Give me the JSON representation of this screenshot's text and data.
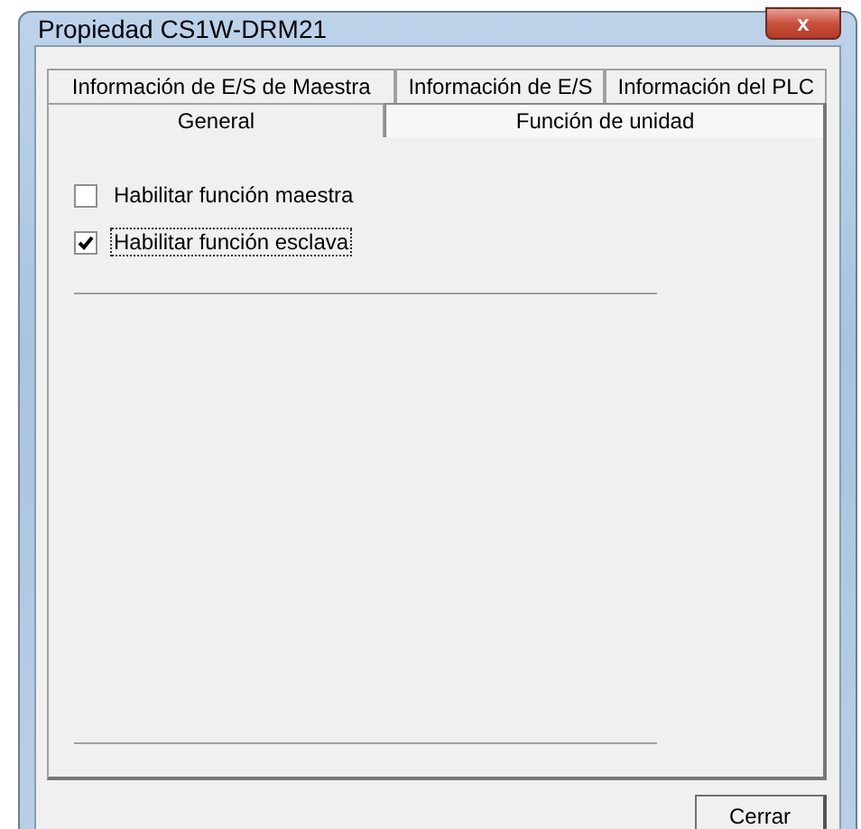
{
  "window": {
    "title": "Propiedad CS1W-DRM21",
    "close": "x"
  },
  "tab_rows": [
    [
      {
        "label": "Información de E/S de Maestra",
        "selected": false
      },
      {
        "label": "Información de E/S",
        "selected": false
      },
      {
        "label": "Información del PLC",
        "selected": false
      }
    ],
    [
      {
        "label": "General",
        "selected": false
      },
      {
        "label": "Función de unidad",
        "selected": true
      }
    ]
  ],
  "options": [
    {
      "label": "Habilitar función maestra",
      "checked": false,
      "focused": false
    },
    {
      "label": "Habilitar función esclava",
      "checked": true,
      "focused": true
    }
  ],
  "buttons": [
    "Cerrar"
  ]
}
